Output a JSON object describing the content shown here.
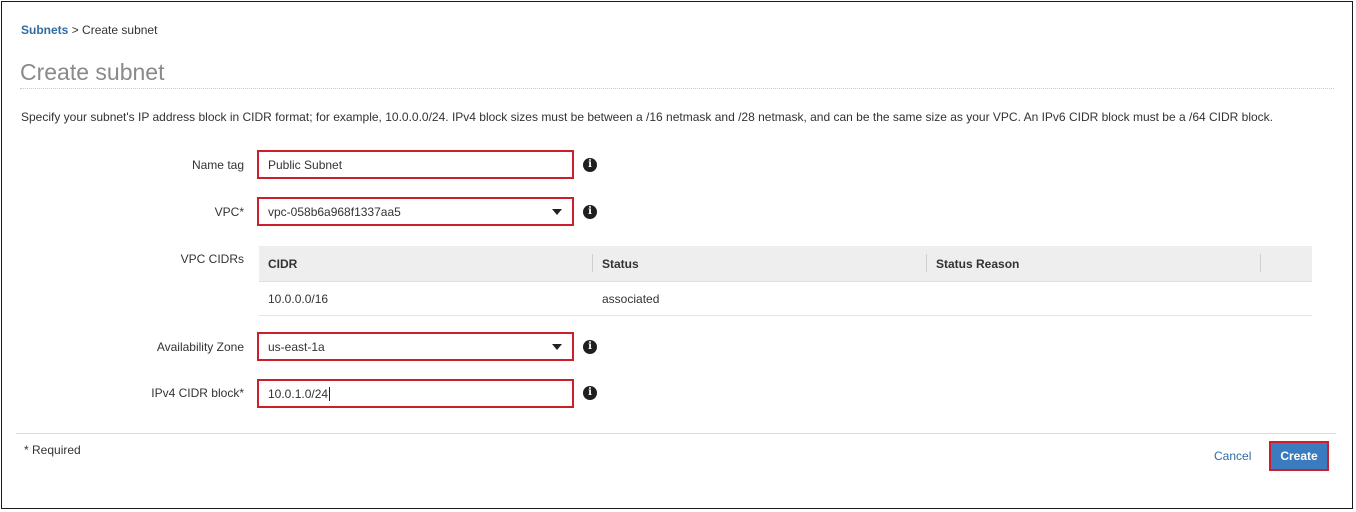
{
  "breadcrumb": {
    "parent": "Subnets",
    "separator": ">",
    "current": "Create subnet"
  },
  "page_title": "Create subnet",
  "description": "Specify your subnet's IP address block in CIDR format; for example, 10.0.0.0/24. IPv4 block sizes must be between a /16 netmask and /28 netmask, and can be the same size as your VPC. An IPv6 CIDR block must be a /64 CIDR block.",
  "form": {
    "name_tag": {
      "label": "Name tag",
      "value": "Public Subnet"
    },
    "vpc": {
      "label": "VPC*",
      "value": "vpc-058b6a968f1337aa5"
    },
    "vpc_cidrs": {
      "label": "VPC CIDRs",
      "columns": [
        "CIDR",
        "Status",
        "Status Reason"
      ],
      "rows": [
        {
          "cidr": "10.0.0.0/16",
          "status": "associated",
          "status_reason": ""
        }
      ]
    },
    "availability_zone": {
      "label": "Availability Zone",
      "value": "us-east-1a"
    },
    "ipv4_cidr": {
      "label": "IPv4 CIDR block*",
      "value": "10.0.1.0/24"
    }
  },
  "info_glyph": "i",
  "footer": {
    "required_note": "* Required",
    "cancel_label": "Cancel",
    "create_label": "Create"
  },
  "colors": {
    "link": "#2e6da4",
    "highlight_border": "#cc1f2b",
    "primary_button": "#3b7cc1"
  },
  "icons": {
    "info": "info-icon",
    "dropdown": "chevron-down-icon"
  }
}
